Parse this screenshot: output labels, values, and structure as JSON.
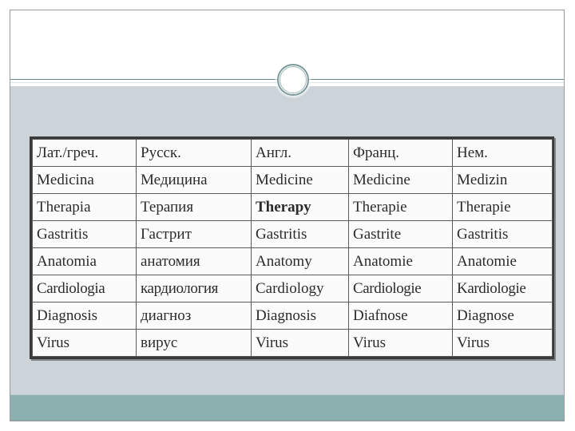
{
  "slide": {
    "theme": {
      "header_background": "#ffffff",
      "body_background": "#ccd4da",
      "footer_background": "#8cb0b0",
      "rule_color": "#6e8a8c",
      "ring_color": "#7d9a9c",
      "highlight_color": "#a11324",
      "table_border_color": "#3b3b3b"
    },
    "decorations": {
      "ring_label": "decorative-ring",
      "rule_label": "header-divider"
    }
  },
  "table": {
    "columns": [
      "Лат./греч.",
      "Русск.",
      "Англ.",
      "Франц.",
      "Нем."
    ],
    "rows": [
      {
        "cells": [
          "Medicina",
          "Медицина",
          "Medicine",
          "Medicine",
          "Medizin"
        ],
        "highlight": -1
      },
      {
        "cells": [
          "Therapia",
          "Терапия",
          "Therapy",
          "Therapie",
          "Therapie"
        ],
        "highlight": 2
      },
      {
        "cells": [
          "Gastritis",
          "Гастрит",
          "Gastritis",
          "Gastrite",
          "Gastritis"
        ],
        "highlight": -1
      },
      {
        "cells": [
          "Anatomia",
          "анатомия",
          "Anatomy",
          "Anatomie",
          "Anatomie"
        ],
        "highlight": -1
      },
      {
        "cells": [
          "Cardiologia",
          "кардиология",
          "Cardiology",
          "Cardiologie",
          "Kardiologie"
        ],
        "highlight": -1
      },
      {
        "cells": [
          "Diagnosis",
          "диагноз",
          "Diagnosis",
          "Diafnose",
          "Diagnose"
        ],
        "highlight": -1
      },
      {
        "cells": [
          "Virus",
          "вирус",
          "Virus",
          "Virus",
          "Virus"
        ],
        "highlight": -1
      }
    ]
  }
}
